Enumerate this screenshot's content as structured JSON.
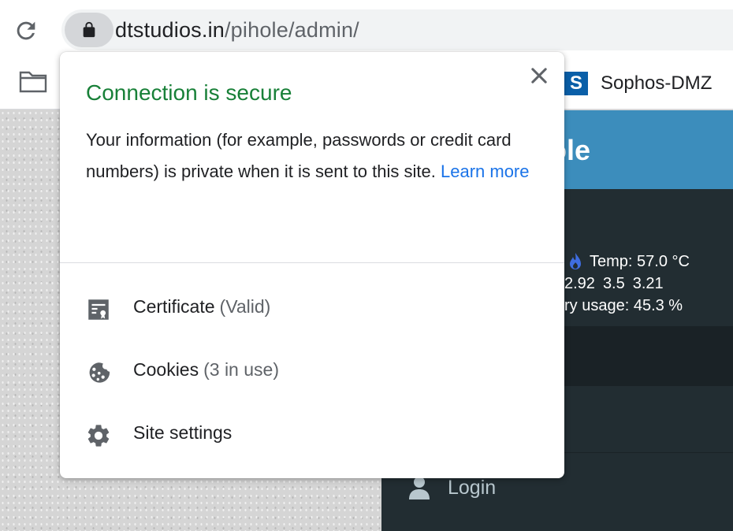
{
  "browser": {
    "url_host": "dtstudios.in",
    "url_path": "/pihole/admin/",
    "bookmarks": [
      {
        "label": "Sophos-DMZ",
        "logo_letter": "S",
        "icon": "sophos-logo-icon"
      }
    ]
  },
  "popup": {
    "title": "Connection is secure",
    "description": "Your information (for example, passwords or credit card numbers) is private when it is sent to this site.",
    "learn_more": "Learn more",
    "items": [
      {
        "label": "Certificate",
        "sub": "(Valid)",
        "icon": "certificate-icon"
      },
      {
        "label": "Cookies",
        "sub": "(3 in use)",
        "icon": "cookie-icon"
      },
      {
        "label": "Site settings",
        "sub": "",
        "icon": "gear-icon"
      }
    ]
  },
  "page": {
    "logo_partial": "ole",
    "temp": "Temp: 57.0 °C",
    "load": [
      "2.92",
      "3.5",
      "3.21"
    ],
    "memory": "ry usage:  45.3 %",
    "login": "Login"
  },
  "colors": {
    "secure_green": "#188038",
    "link_blue": "#1a73e8",
    "pihole_header": "#3c8dbc",
    "pihole_sidebar": "#222d32"
  }
}
